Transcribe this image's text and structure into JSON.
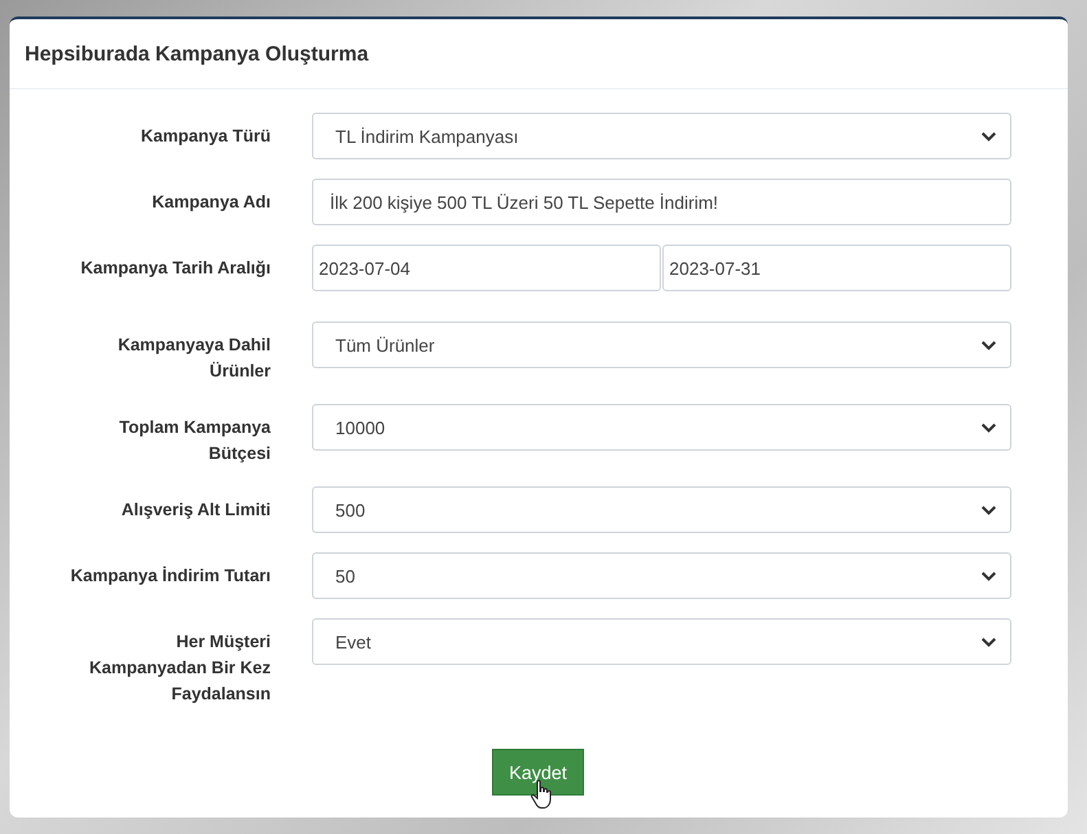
{
  "panel": {
    "title": "Hepsiburada Kampanya Oluşturma"
  },
  "fields": [
    {
      "label": "Kampanya Türü",
      "kind": "select",
      "value": "TL İndirim Kampanyası"
    },
    {
      "label": "Kampanya Adı",
      "kind": "text",
      "value": "İlk 200 kişiye 500 TL Üzeri 50 TL Sepette İndirim!"
    },
    {
      "label": "Kampanya Tarih Aralığı",
      "kind": "daterange",
      "start": "2023-07-04",
      "end": "2023-07-31"
    },
    {
      "label": "Kampanyaya Dahil Ürünler",
      "kind": "select",
      "value": "Tüm Ürünler"
    },
    {
      "label": "Toplam Kampanya Bütçesi",
      "kind": "select",
      "value": "10000"
    },
    {
      "label": "Alışveriş Alt Limiti",
      "kind": "select",
      "value": "500"
    },
    {
      "label": "Kampanya İndirim Tutarı",
      "kind": "select",
      "value": "50"
    },
    {
      "label": "Her Müşteri Kampanyadan Bir Kez Faydalansın",
      "kind": "select",
      "value": "Evet"
    }
  ],
  "submit": {
    "label": "Kaydet"
  }
}
